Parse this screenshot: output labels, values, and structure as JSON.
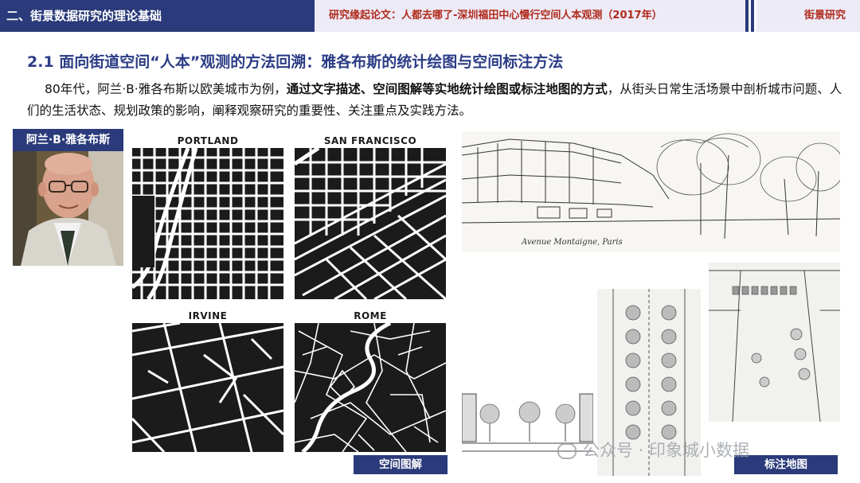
{
  "header": {
    "section": "二、街景数据研究的理论基础",
    "source": "研究缘起论文：人都去哪了-深圳福田中心慢行空间人本观测（2017年）",
    "tag": "街景研究"
  },
  "title": "2.1 面向街道空间“人本”观测的方法回溯：雅各布斯的统计绘图与空间标注方法",
  "paragraph": {
    "part1": "80年代，阿兰·B·雅各布斯以欧美城市为例，",
    "bold": "通过文字描述、空间图解等实地统计绘图或标注地图的方式",
    "part2": "，从街头日常生活场景中剖析城市问题、人们的生活状态、规划政策的影响，阐释观察研究的重要性、关注重点及实践方法。"
  },
  "portrait_label": "阿兰·B·雅各布斯",
  "maps": [
    "PORTLAND",
    "SAN FRANCISCO",
    "IRVINE",
    "ROME"
  ],
  "sketch_caption": "Avenue Montaigne, Paris",
  "captions": {
    "spatial_diagram": "空间图解",
    "annotated_map": "标注地图"
  },
  "watermark": "公众号 · 印象城小数据",
  "colors": {
    "navy": "#2a3a7a",
    "title_blue": "#2b3c86",
    "header_red": "#b12a1c",
    "header_bg": "#ecebf6"
  }
}
